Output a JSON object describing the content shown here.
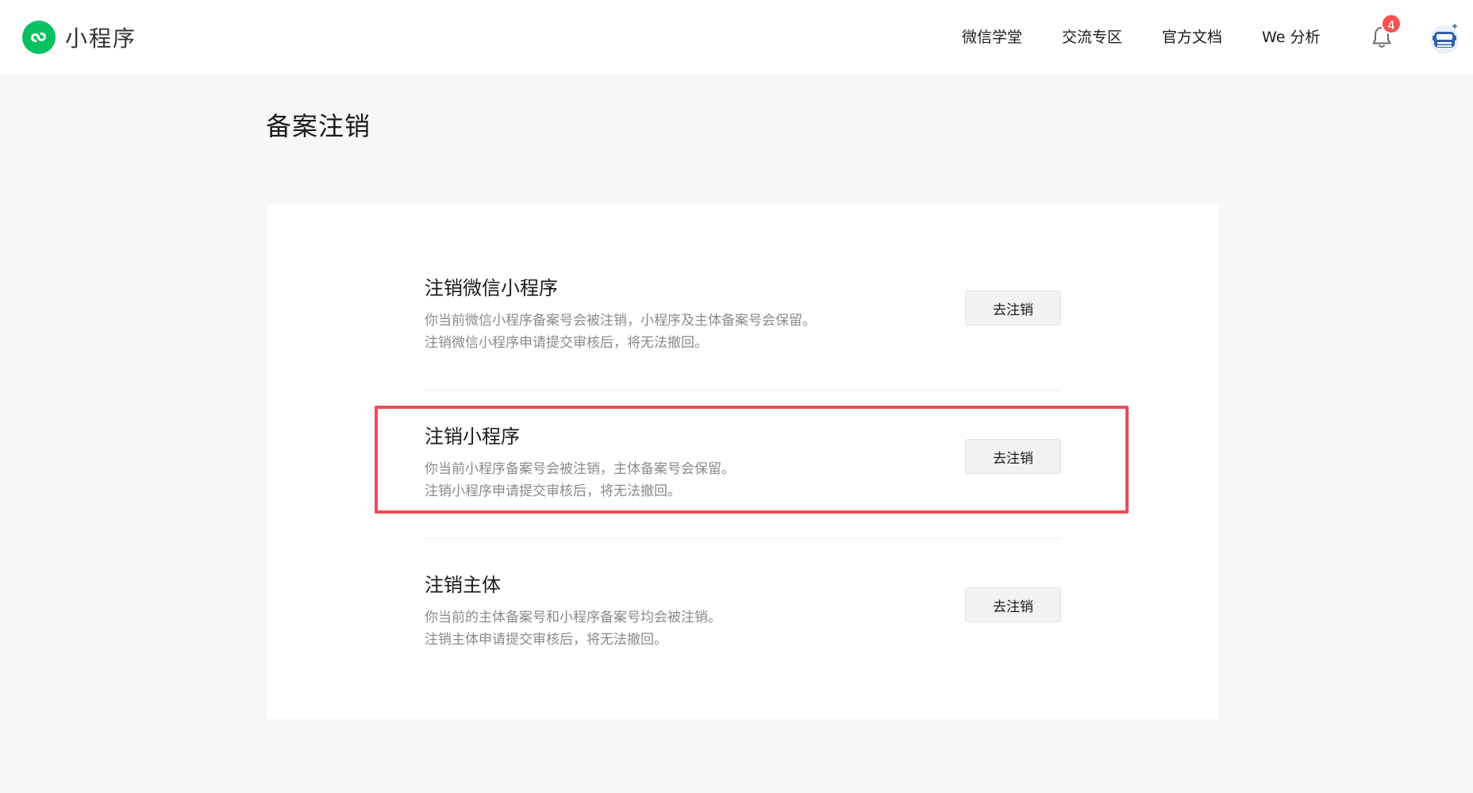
{
  "header": {
    "app_name": "小程序",
    "nav": [
      "微信学堂",
      "交流专区",
      "官方文档",
      "We 分析"
    ],
    "notification_count": "4",
    "brand_color": "#07c160",
    "badge_color": "#fa5151"
  },
  "page": {
    "title": "备案注销"
  },
  "options": [
    {
      "title": "注销微信小程序",
      "desc_line1": "你当前微信小程序备案号会被注销，小程序及主体备案号会保留。",
      "desc_line2": "注销微信小程序申请提交审核后，将无法撤回。",
      "button": "去注销"
    },
    {
      "title": "注销小程序",
      "desc_line1": "你当前小程序备案号会被注销，主体备案号会保留。",
      "desc_line2": "注销小程序申请提交审核后，将无法撤回。",
      "button": "去注销",
      "highlighted": true
    },
    {
      "title": "注销主体",
      "desc_line1": "你当前的主体备案号和小程序备案号均会被注销。",
      "desc_line2": "注销主体申请提交审核后，将无法撤回。",
      "button": "去注销"
    }
  ],
  "highlight_color": "#ef4b57"
}
